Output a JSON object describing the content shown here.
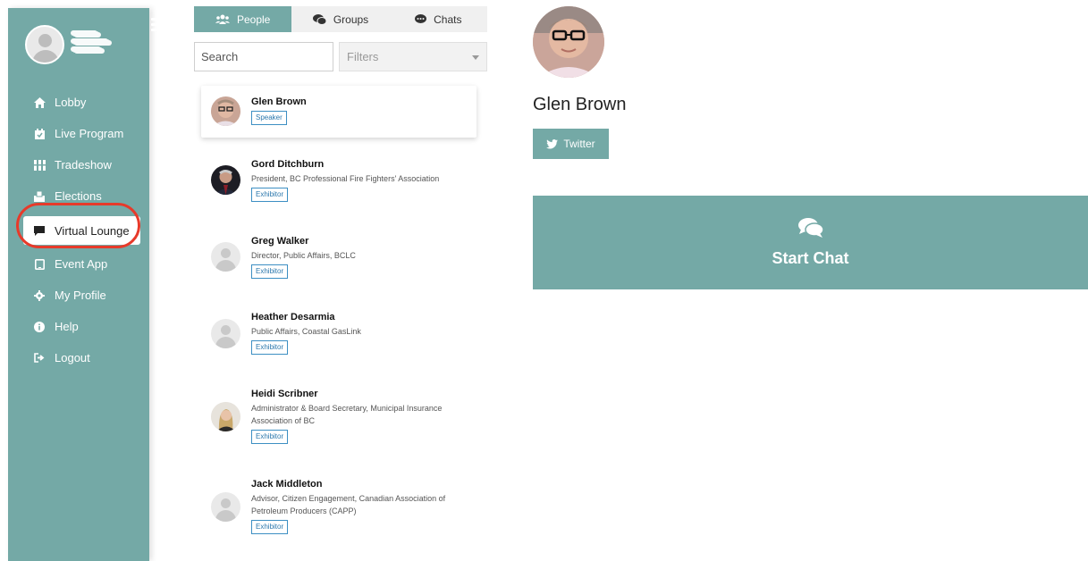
{
  "sidebar": {
    "nav": [
      {
        "label": "Lobby",
        "icon": "home-icon"
      },
      {
        "label": "Live Program",
        "icon": "calendar-check-icon"
      },
      {
        "label": "Tradeshow",
        "icon": "booth-icon"
      },
      {
        "label": "Elections",
        "icon": "ballot-box-icon"
      },
      {
        "label": "Virtual Lounge",
        "icon": "comment-icon"
      },
      {
        "label": "Event App",
        "icon": "tablet-icon"
      },
      {
        "label": "My Profile",
        "icon": "gear-icon"
      },
      {
        "label": "Help",
        "icon": "info-circle-icon"
      },
      {
        "label": "Logout",
        "icon": "sign-out-icon"
      }
    ],
    "active": "Virtual Lounge"
  },
  "tabs": [
    {
      "label": "People",
      "icon": "users-icon",
      "active": true
    },
    {
      "label": "Groups",
      "icon": "comments-icon",
      "active": false
    },
    {
      "label": "Chats",
      "icon": "comment-dots-icon",
      "active": false
    }
  ],
  "search": {
    "placeholder": "Search"
  },
  "filters": {
    "label": "Filters"
  },
  "people": [
    {
      "name": "Glen Brown",
      "title": "",
      "badge": "Speaker",
      "photo": true
    },
    {
      "name": "Gord Ditchburn",
      "title": "President, BC Professional Fire Fighters' Association",
      "badge": "Exhibitor",
      "photo": true
    },
    {
      "name": "Greg Walker",
      "title": "Director, Public Affairs, BCLC",
      "badge": "Exhibitor",
      "photo": false
    },
    {
      "name": "Heather Desarmia",
      "title": "Public Affairs, Coastal GasLink",
      "badge": "Exhibitor",
      "photo": false
    },
    {
      "name": "Heidi Scribner",
      "title": "Administrator & Board Secretary, Municipal Insurance Association of BC",
      "badge": "Exhibitor",
      "photo": true
    },
    {
      "name": "Jack Middleton",
      "title": "Advisor, Citizen Engagement, Canadian Association of Petroleum Producers (CAPP)",
      "badge": "Exhibitor",
      "photo": false
    }
  ],
  "detail": {
    "name": "Glen Brown",
    "twitter_label": "Twitter",
    "start_chat_label": "Start Chat"
  },
  "colors": {
    "accent": "#74a9a6",
    "highlight": "#e73a2a",
    "badge": "#2c78ad"
  }
}
